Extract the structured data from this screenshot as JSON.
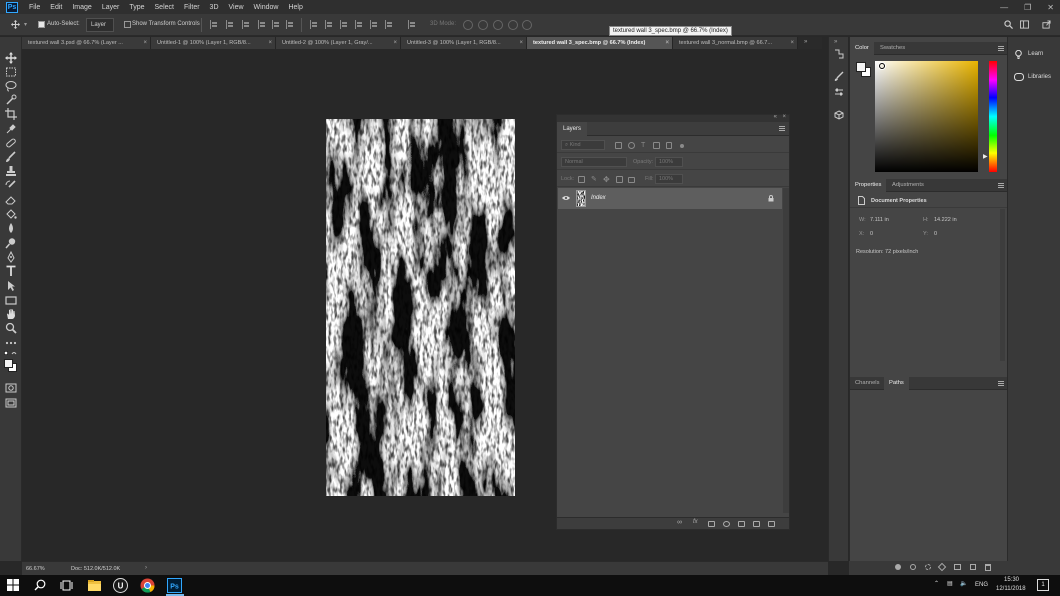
{
  "app": {
    "logo": "Ps",
    "menu": [
      "File",
      "Edit",
      "Image",
      "Layer",
      "Type",
      "Select",
      "Filter",
      "3D",
      "View",
      "Window",
      "Help"
    ]
  },
  "options": {
    "auto_select_label": "Auto-Select:",
    "auto_select_value": "Layer",
    "transform_label": "Show Transform Controls",
    "mode_3d_label": "3D Mode:"
  },
  "tooltip": "textured wall 3_spec.bmp @ 66.7% (Index)",
  "tabs": [
    {
      "label": "textured wall 3.psd @ 66.7% (Layer ...",
      "active": false
    },
    {
      "label": "Untitled-1 @ 100% (Layer 1, RGB/8...",
      "active": false
    },
    {
      "label": "Untitled-2 @ 100% (Layer 1, Gray/...",
      "active": false
    },
    {
      "label": "Untitled-3 @ 100% (Layer 1, RGB/8...",
      "active": false
    },
    {
      "label": "textured wall 3_spec.bmp @ 66.7% (Index)",
      "active": true
    },
    {
      "label": "textured wall 3_normal.bmp @ 66.7...",
      "active": false
    }
  ],
  "layers_panel": {
    "tab": "Layers",
    "kind_placeholder": "Kind",
    "blend_mode": "Normal",
    "opacity_label": "Opacity:",
    "opacity_value": "100%",
    "lock_label": "Lock:",
    "fill_label": "Fill:",
    "fill_value": "100%",
    "layer_name": "Index"
  },
  "color_panel": {
    "tabs": [
      "Color",
      "Swatches"
    ],
    "hue_color": "#e8b400"
  },
  "properties_panel": {
    "tabs": [
      "Properties",
      "Adjustments"
    ],
    "heading": "Document Properties",
    "w_label": "W:",
    "w_value": "7.111 in",
    "h_label": "H:",
    "h_value": "14.222 in",
    "x_label": "X:",
    "x_value": "0",
    "y_label": "Y:",
    "y_value": "0",
    "resolution": "Resolution: 72 pixels/inch"
  },
  "paths_panel": {
    "tabs": [
      "Channels",
      "Paths"
    ]
  },
  "learn_panel": {
    "items": [
      "Learn",
      "Libraries"
    ]
  },
  "status": {
    "zoom": "66.67%",
    "doc": "Doc: 512.0K/512.0K"
  },
  "taskbar": {
    "language": "ENG",
    "time": "15:30",
    "date": "12/11/2018",
    "notifications": "1"
  }
}
